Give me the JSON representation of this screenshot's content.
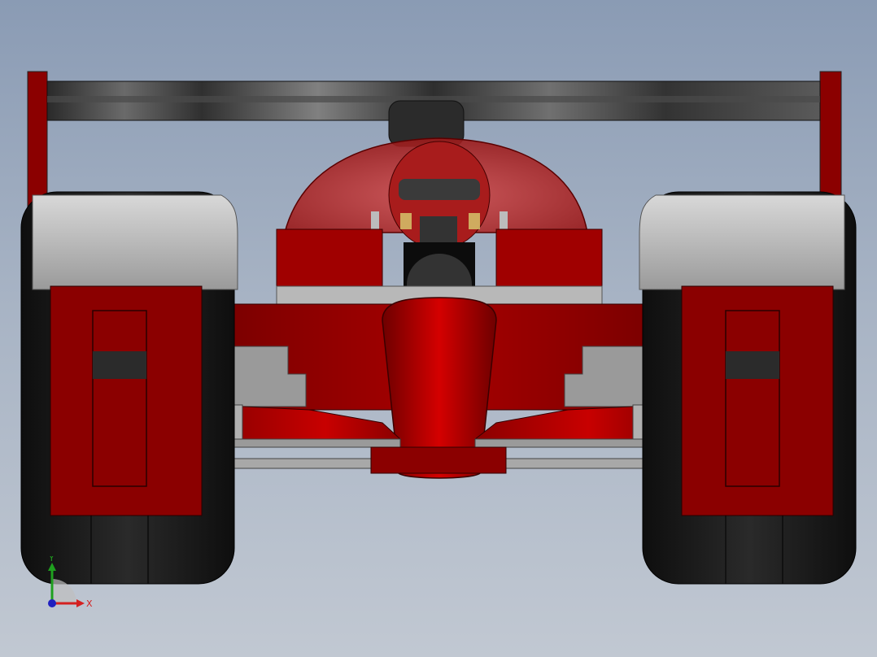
{
  "viewport": {
    "background_top": "#8a9bb4",
    "background_bottom": "#c1c8d2"
  },
  "model": {
    "body_color": "#8b0000",
    "highlight_color": "#c40000",
    "tire_color": "#1e1e1e",
    "carbon_color": "#3a3a3a"
  },
  "triad": {
    "y_label": "Y",
    "x_label": "X",
    "y_color": "#1fa01f",
    "x_color": "#d42020",
    "z_color": "#2020c0"
  }
}
